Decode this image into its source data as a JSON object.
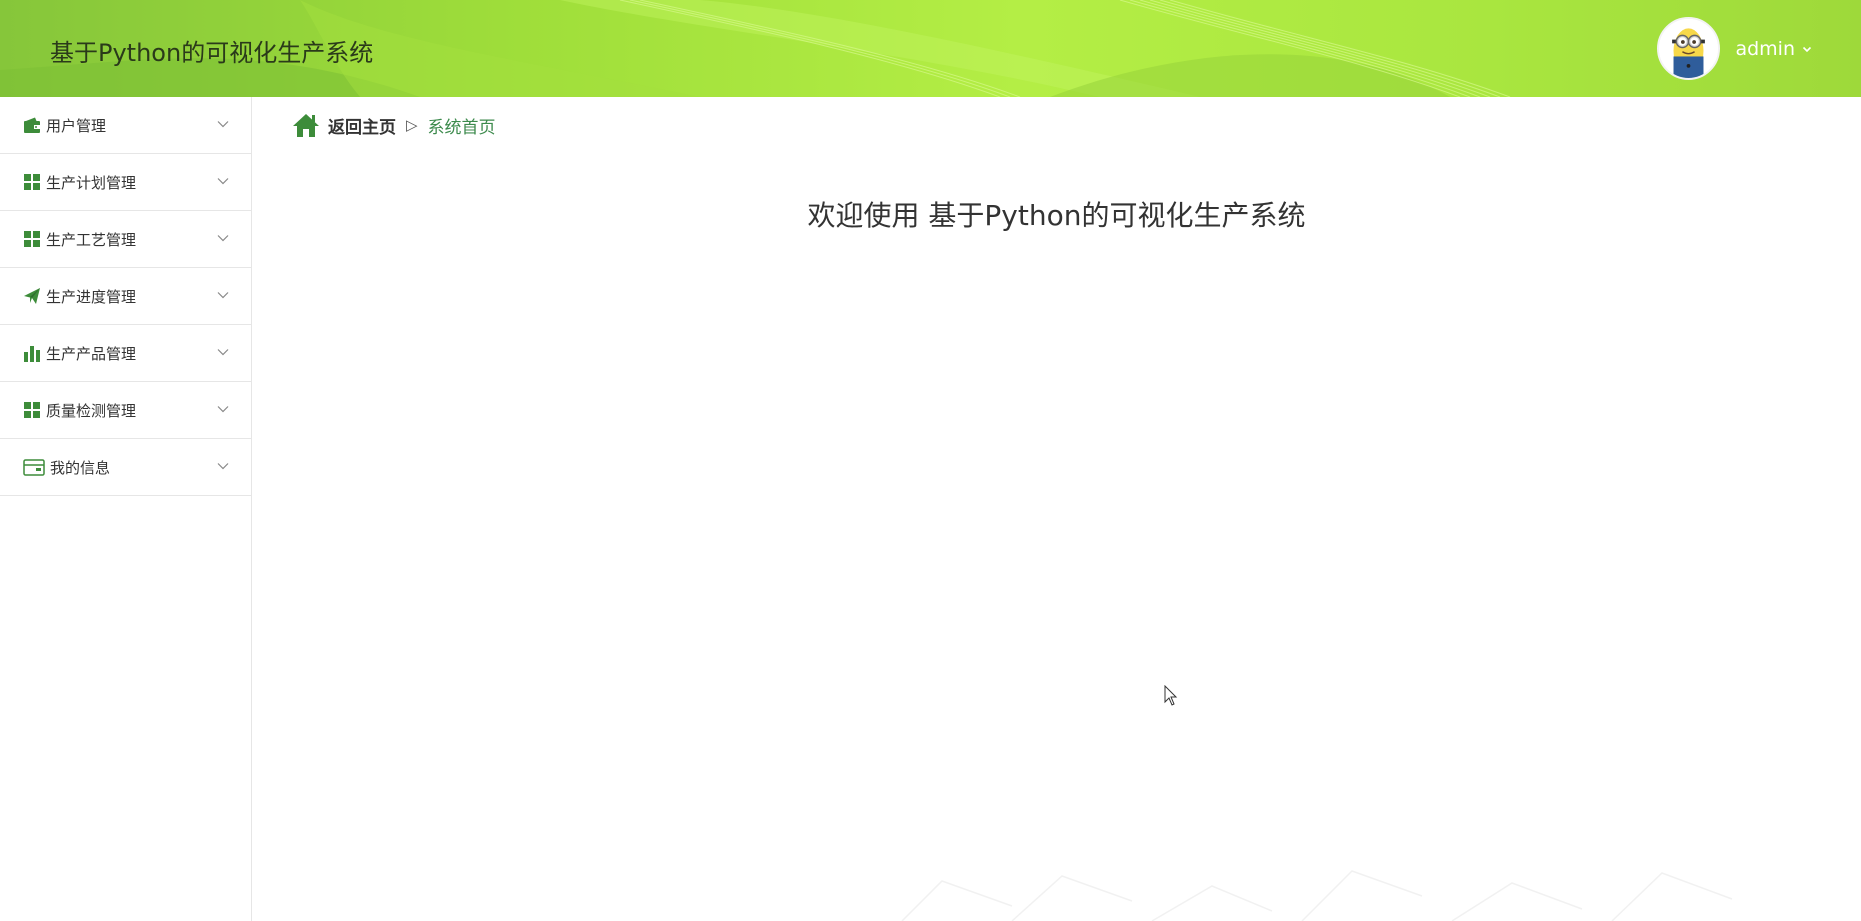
{
  "header": {
    "title": "基于Python的可视化生产系统",
    "username": "admin"
  },
  "sidebar": {
    "items": [
      {
        "label": "用户管理",
        "icon": "wallet-icon"
      },
      {
        "label": "生产计划管理",
        "icon": "grid-icon"
      },
      {
        "label": "生产工艺管理",
        "icon": "grid-icon"
      },
      {
        "label": "生产进度管理",
        "icon": "paper-plane-icon"
      },
      {
        "label": "生产产品管理",
        "icon": "bar-chart-icon"
      },
      {
        "label": "质量检测管理",
        "icon": "grid-icon"
      },
      {
        "label": "我的信息",
        "icon": "card-icon"
      }
    ]
  },
  "breadcrumb": {
    "home": "返回主页",
    "separator": "▷",
    "current": "系统首页"
  },
  "main": {
    "welcome": "欢迎使用 基于Python的可视化生产系统"
  },
  "colors": {
    "accent": "#3c8a4c",
    "header_gradient_start": "#86c63a",
    "header_gradient_end": "#b4ee45",
    "icon_green": "#3d8c3a"
  }
}
